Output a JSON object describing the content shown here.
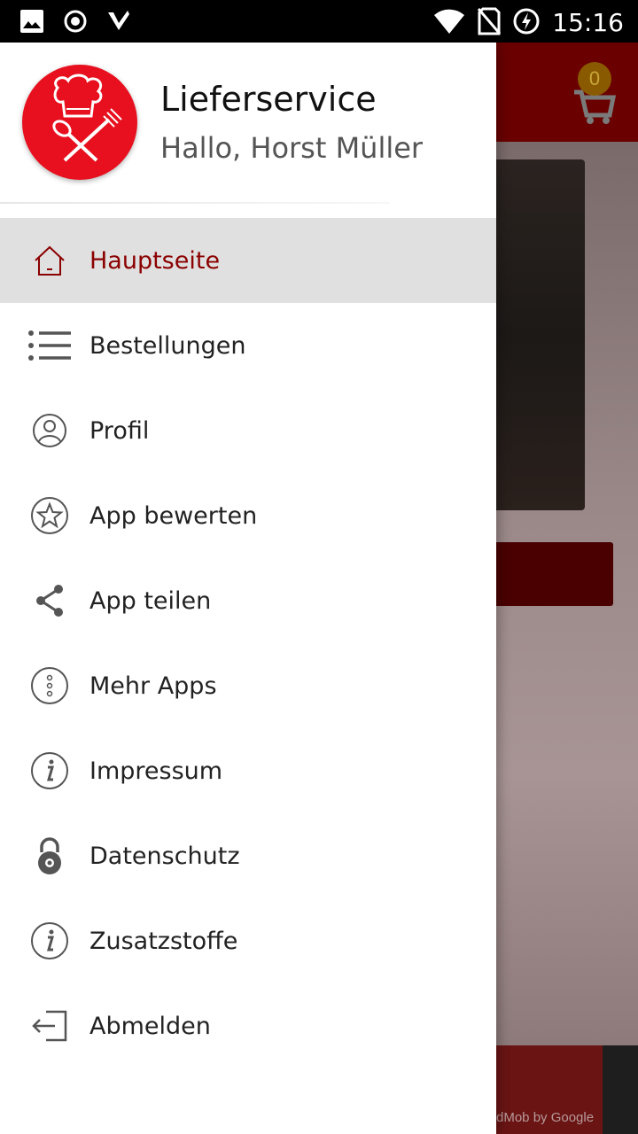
{
  "status_bar": {
    "time": "15:16",
    "left_icons": [
      "image-icon",
      "record-icon",
      "checkmark-icon"
    ],
    "right_icons": [
      "wifi-icon",
      "no-sim-icon",
      "battery-charging-icon"
    ]
  },
  "background": {
    "cart_count": "0",
    "ad_text": "dMob by Google"
  },
  "drawer": {
    "app_name": "Lieferservice",
    "greeting": "Hallo, Horst Müller",
    "items": [
      {
        "label": "Hauptseite",
        "icon": "home-icon",
        "active": true
      },
      {
        "label": "Bestellungen",
        "icon": "list-icon"
      },
      {
        "label": "Profil",
        "icon": "profile-icon"
      },
      {
        "label": "App bewerten",
        "icon": "star-icon"
      },
      {
        "label": "App teilen",
        "icon": "share-icon"
      },
      {
        "label": "Mehr Apps",
        "icon": "more-icon"
      },
      {
        "label": "Impressum",
        "icon": "info-icon"
      },
      {
        "label": "Datenschutz",
        "icon": "lock-icon"
      },
      {
        "label": "Zusatzstoffe",
        "icon": "info-icon"
      },
      {
        "label": "Abmelden",
        "icon": "logout-icon"
      }
    ]
  },
  "colors": {
    "accent": "#8b0000",
    "logo_red": "#e8101e",
    "active_bg": "#e0e0e0"
  }
}
